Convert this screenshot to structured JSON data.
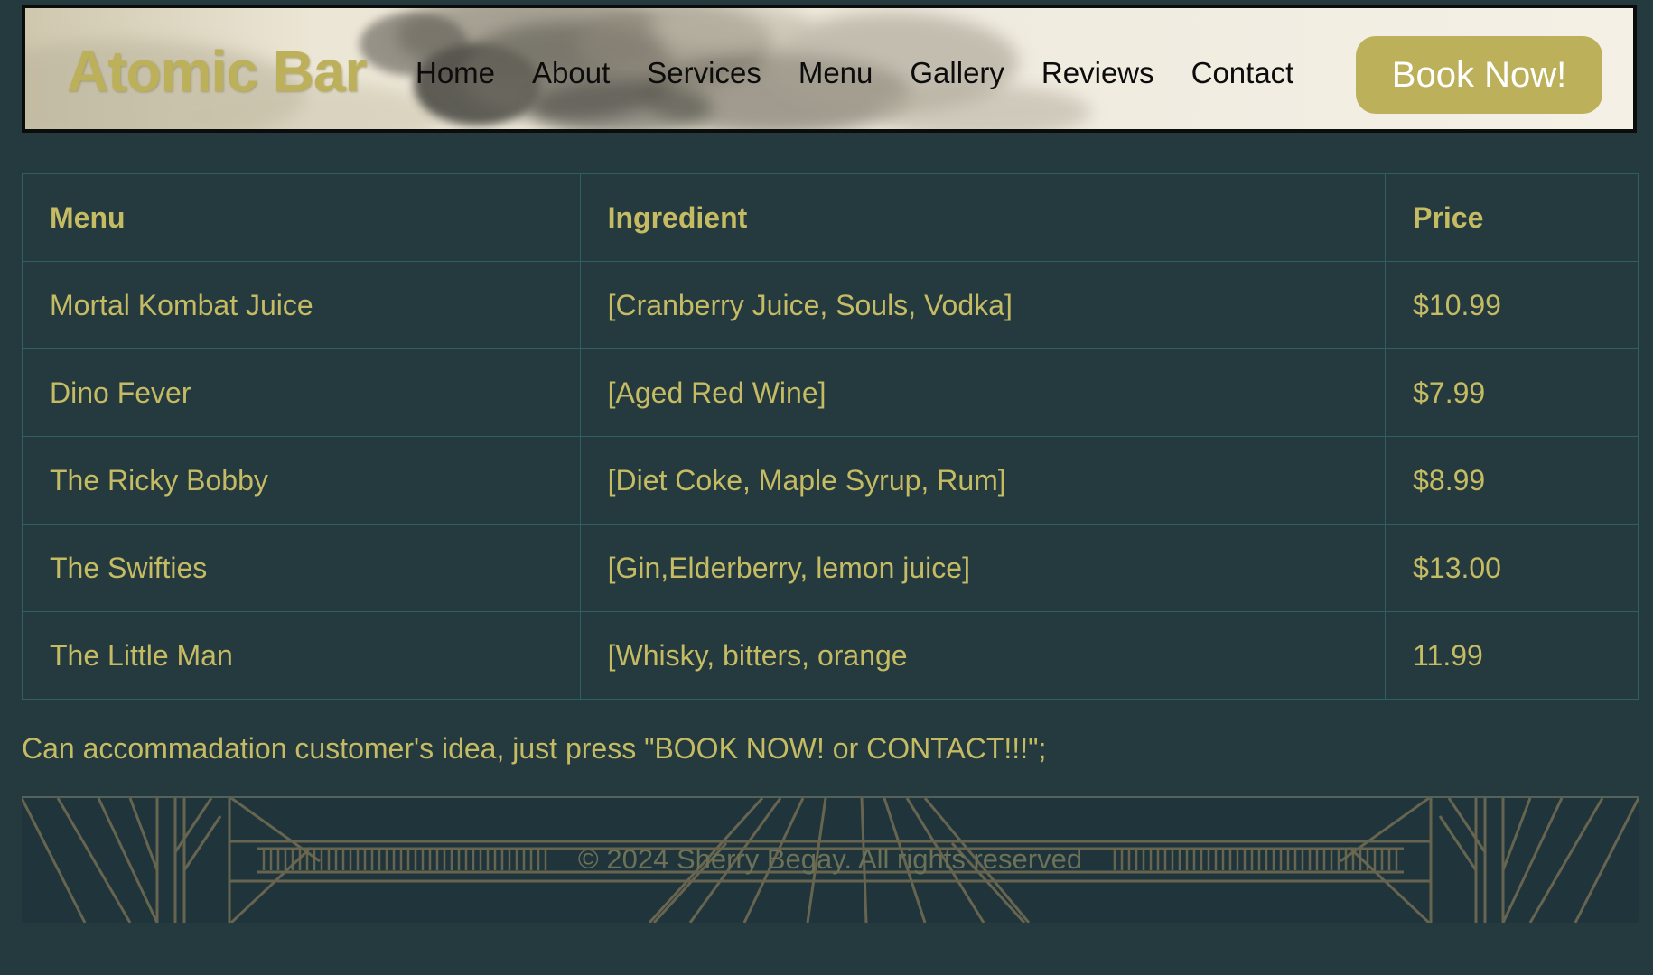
{
  "brand": {
    "name": "Atomic Bar"
  },
  "nav": {
    "items": [
      "Home",
      "About",
      "Services",
      "Menu",
      "Gallery",
      "Reviews",
      "Contact"
    ]
  },
  "cta": {
    "label": "Book Now!"
  },
  "table": {
    "headers": [
      "Menu",
      "Ingredient",
      "Price"
    ],
    "rows": [
      [
        "Mortal Kombat Juice",
        "[Cranberry Juice, Souls, Vodka]",
        "$10.99"
      ],
      [
        "Dino Fever",
        "[Aged Red Wine]",
        "$7.99"
      ],
      [
        "The Ricky Bobby",
        "[Diet Coke, Maple Syrup, Rum]",
        "$8.99"
      ],
      [
        "The Swifties",
        "[Gin,Elderberry, lemon juice]",
        "$13.00"
      ],
      [
        "The Little Man",
        "[Whisky, bitters, orange",
        "11.99"
      ]
    ]
  },
  "note": "Can accommadation customer's idea, just press \"BOOK NOW! or CONTACT!!!\";",
  "footer": {
    "copyright": "© 2024 Sherry Begay. All rights reserved"
  },
  "colors": {
    "page_background": "#243a3f",
    "accent_gold": "#bcb05b",
    "table_text": "#c5bb63",
    "table_border": "#2e6063",
    "header_background": "#f1ece0",
    "footer_background": "#1f353b"
  },
  "icons": {
    "header_background": "smoke-cloud-image",
    "footer_background": "art-deco-pattern"
  }
}
